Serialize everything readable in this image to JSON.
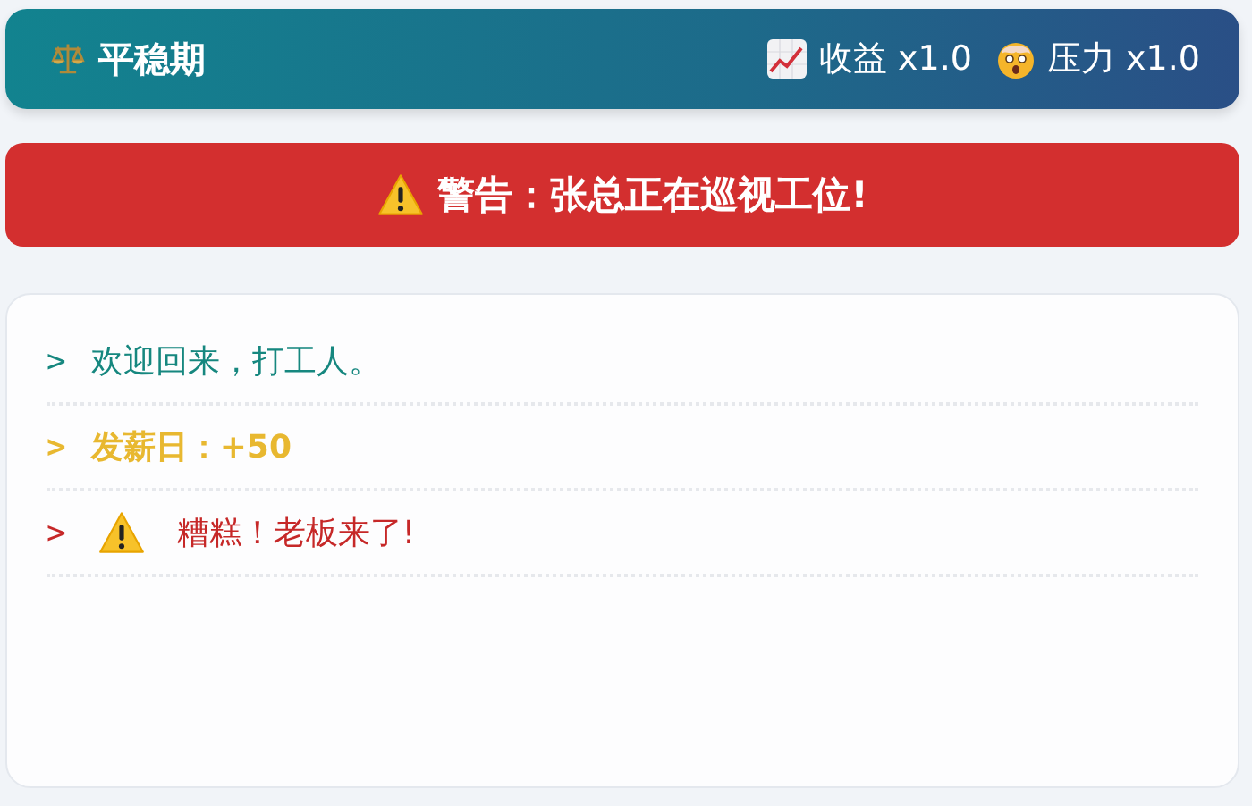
{
  "status_bar": {
    "phase": "平稳期",
    "stats": [
      {
        "kind": "income",
        "label": "收益 x1.0"
      },
      {
        "kind": "stress",
        "label": "压力 x1.0"
      }
    ]
  },
  "alert": {
    "kind": "warning",
    "text": "警告：张总正在巡视工位!"
  },
  "log": [
    {
      "kind": "info",
      "prompt": ">",
      "text": "欢迎回来，打工人。"
    },
    {
      "kind": "success",
      "prompt": ">",
      "text": "发薪日：+50"
    },
    {
      "kind": "danger",
      "prompt": ">",
      "text": "糟糕！老板来了!"
    }
  ]
}
